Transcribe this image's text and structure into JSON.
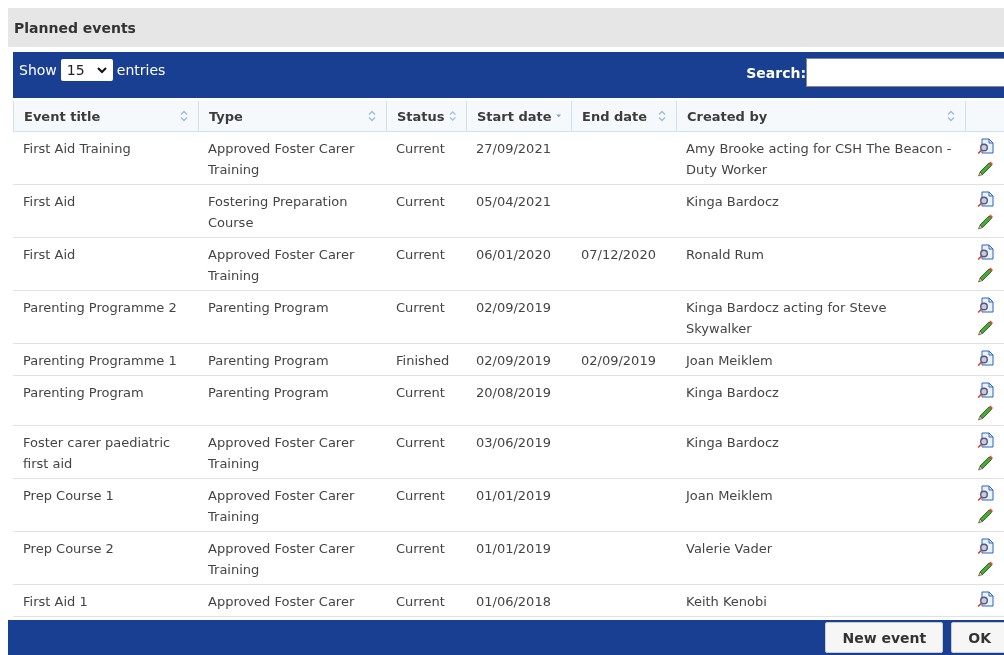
{
  "panel": {
    "title": "Planned events"
  },
  "length_menu": {
    "label_before": "Show",
    "value": "15",
    "label_after": "entries"
  },
  "search": {
    "label": "Search:"
  },
  "columns": [
    {
      "label": "Event title",
      "sorted": false
    },
    {
      "label": "Type",
      "sorted": false
    },
    {
      "label": "Status",
      "sorted": false
    },
    {
      "label": "Start date",
      "sorted": true
    },
    {
      "label": "End date",
      "sorted": false
    },
    {
      "label": "Created by",
      "sorted": false
    }
  ],
  "rows": [
    {
      "cells": [
        "First Aid Training",
        "Approved Foster Carer Training",
        "Current",
        "27/09/2021",
        "",
        "Amy Brooke acting for CSH The Beacon - Duty Worker"
      ],
      "editable": true
    },
    {
      "cells": [
        "First Aid",
        "Fostering Preparation Course",
        "Current",
        "05/04/2021",
        "",
        "Kinga Bardocz"
      ],
      "editable": true
    },
    {
      "cells": [
        "First Aid",
        "Approved Foster Carer Training",
        "Current",
        "06/01/2020",
        "07/12/2020",
        "Ronald Rum"
      ],
      "editable": true
    },
    {
      "cells": [
        "Parenting Programme 2",
        "Parenting Program",
        "Current",
        "02/09/2019",
        "",
        "Kinga Bardocz acting for Steve Skywalker"
      ],
      "editable": true
    },
    {
      "cells": [
        "Parenting Programme 1",
        "Parenting Program",
        "Finished",
        "02/09/2019",
        "02/09/2019",
        "Joan Meiklem"
      ],
      "editable": false
    },
    {
      "cells": [
        "Parenting Program",
        "Parenting Program",
        "Current",
        "20/08/2019",
        "",
        "Kinga Bardocz"
      ],
      "editable": true
    },
    {
      "cells": [
        "Foster carer paediatric first aid",
        "Approved Foster Carer Training",
        "Current",
        "03/06/2019",
        "",
        "Kinga Bardocz"
      ],
      "editable": true
    },
    {
      "cells": [
        "Prep Course 1",
        "Approved Foster Carer Training",
        "Current",
        "01/01/2019",
        "",
        "Joan Meiklem"
      ],
      "editable": true
    },
    {
      "cells": [
        "Prep Course 2",
        "Approved Foster Carer Training",
        "Current",
        "01/01/2019",
        "",
        "Valerie Vader"
      ],
      "editable": true
    },
    {
      "cells": [
        "First Aid 1",
        "Approved Foster Carer",
        "Current",
        "01/06/2018",
        "",
        "Keith Kenobi"
      ]
    }
  ],
  "buttons": [
    {
      "label": "New event"
    },
    {
      "label": "OK"
    }
  ]
}
